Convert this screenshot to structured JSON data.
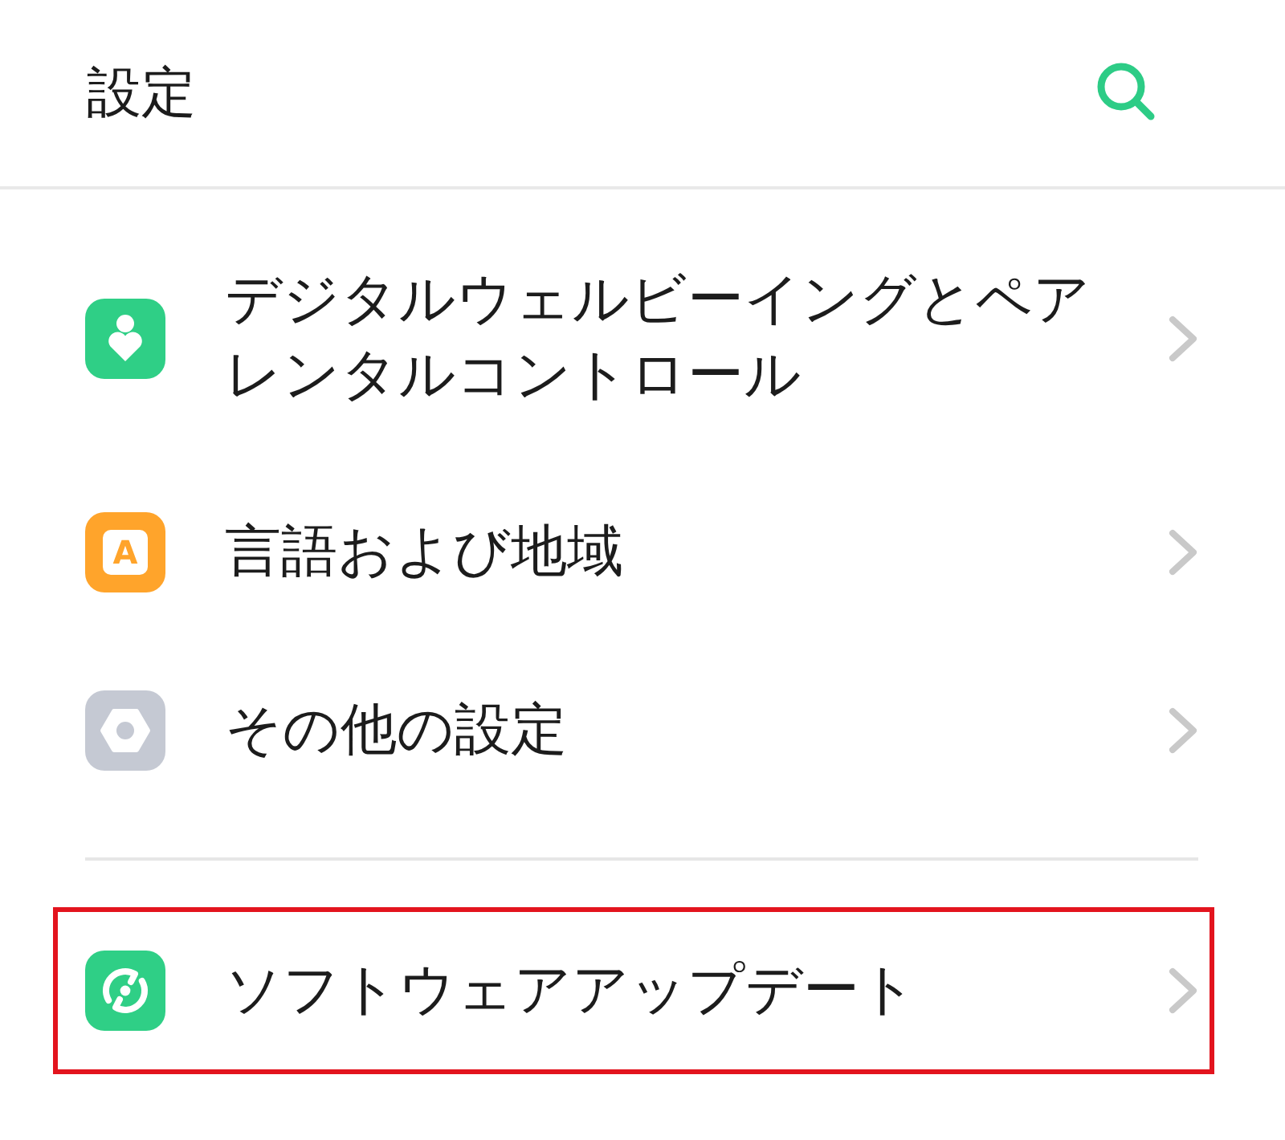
{
  "header": {
    "title": "設定"
  },
  "sections": [
    {
      "items": [
        {
          "kind": "wellbeing",
          "label": "デジタルウェルビーイングとペアレンタルコントロール",
          "highlighted": false
        },
        {
          "kind": "language",
          "icon_letter": "A",
          "label": "言語および地域",
          "highlighted": false
        },
        {
          "kind": "other",
          "label": "その他の設定",
          "highlighted": false
        }
      ]
    },
    {
      "items": [
        {
          "kind": "update",
          "label": "ソフトウェアアップデート",
          "highlighted": true
        }
      ]
    }
  ]
}
